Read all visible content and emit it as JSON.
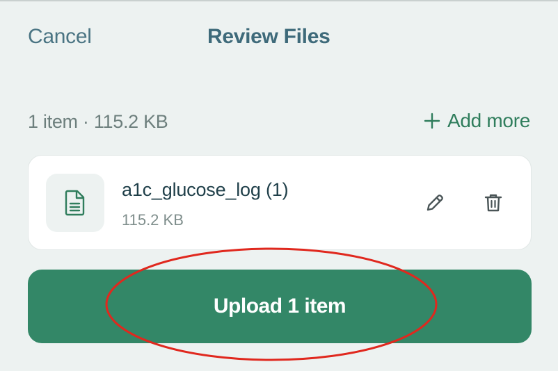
{
  "header": {
    "cancel_label": "Cancel",
    "title": "Review Files"
  },
  "summary": {
    "text": "1 item · 115.2 KB"
  },
  "add_more": {
    "label": "Add more",
    "icon": "plus-icon"
  },
  "files": [
    {
      "name": "a1c_glucose_log (1)",
      "size": "115.2 KB",
      "icon": "document-icon",
      "actions": [
        "pencil-icon",
        "trash-icon"
      ]
    }
  ],
  "upload": {
    "label": "Upload 1 item"
  },
  "colors": {
    "background": "#edf2f1",
    "accent": "#338767",
    "header_text": "#3e6a7a",
    "annotation": "#e0281e"
  }
}
